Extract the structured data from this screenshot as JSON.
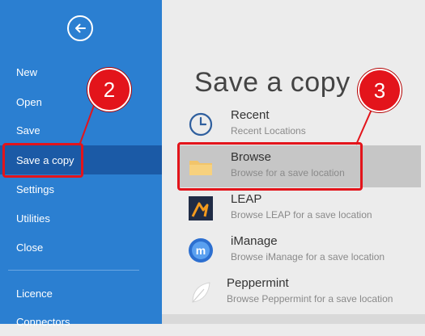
{
  "sidebar": {
    "items": [
      {
        "label": "New"
      },
      {
        "label": "Open"
      },
      {
        "label": "Save"
      },
      {
        "label": "Save a copy"
      },
      {
        "label": "Settings"
      },
      {
        "label": "Utilities"
      },
      {
        "label": "Close"
      },
      {
        "label": "Licence"
      },
      {
        "label": "Connectors"
      }
    ],
    "active_item": "Save a copy"
  },
  "main": {
    "title": "Save a copy",
    "options": [
      {
        "title": "Recent",
        "subtitle": "Recent Locations",
        "icon": "clock-icon"
      },
      {
        "title": "Browse",
        "subtitle": "Browse for a save location",
        "icon": "folder-icon"
      },
      {
        "title": "LEAP",
        "subtitle": "Browse LEAP for a save location",
        "icon": "leap-logo-icon"
      },
      {
        "title": "iManage",
        "subtitle": "Browse iManage for a save location",
        "icon": "imanage-logo-icon"
      },
      {
        "title": "Peppermint",
        "subtitle": "Browse Peppermint for a save location",
        "icon": "peppermint-leaf-icon"
      }
    ],
    "selected_option": "Browse"
  },
  "callouts": [
    {
      "number": "2"
    },
    {
      "number": "3"
    }
  ],
  "colors": {
    "sidebar": "#2b7fd1",
    "sidebar_active": "#1b5aa6",
    "callout_red": "#e3141b",
    "selected_option": "#c6c6c6"
  }
}
